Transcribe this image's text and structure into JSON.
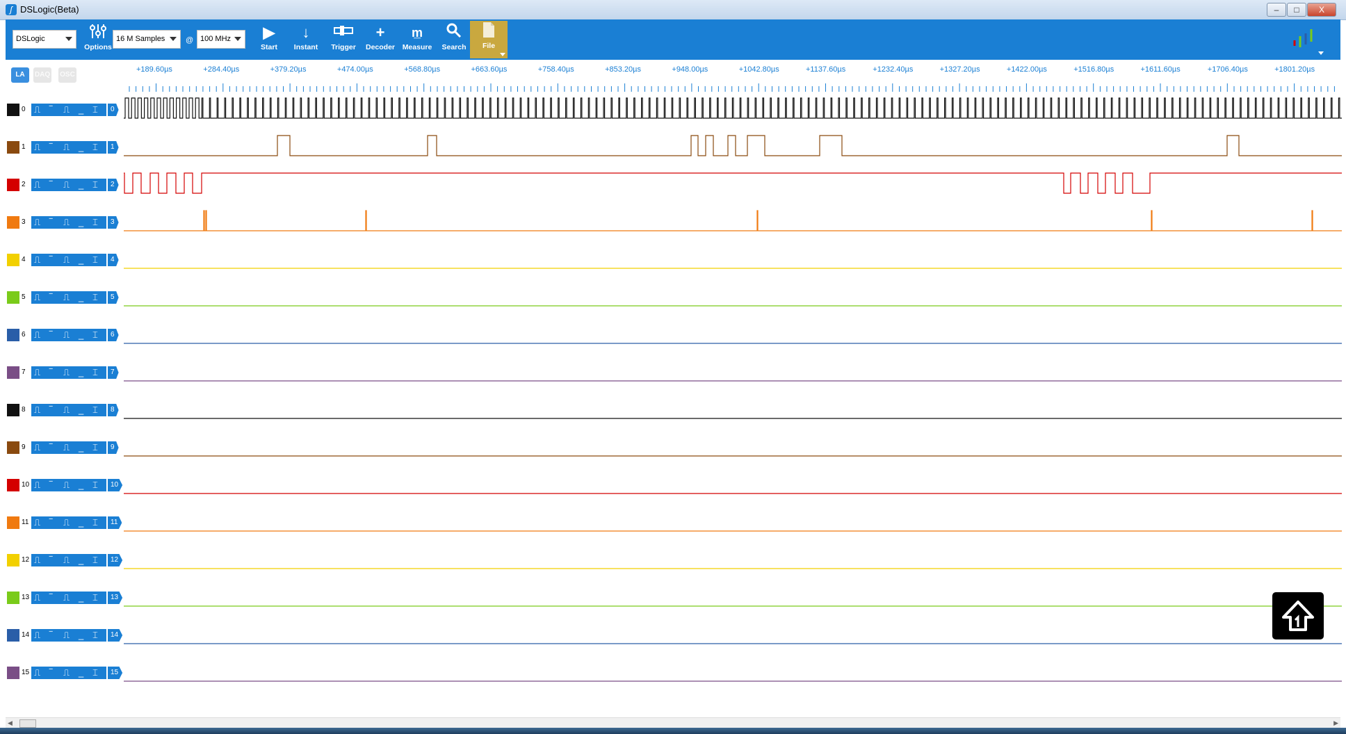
{
  "window": {
    "title": "DSLogic(Beta)",
    "min": "–",
    "max": "□",
    "close": "X"
  },
  "toolbar": {
    "device": "DSLogic",
    "options_label": "Options",
    "samples": "16 M Samples",
    "at": "@",
    "rate": "100 MHz",
    "start_label": "Start",
    "instant_label": "Instant",
    "trigger_label": "Trigger",
    "decoder_label": "Decoder",
    "measure_label": "Measure",
    "search_label": "Search",
    "file_label": "File"
  },
  "modes": {
    "la": "LA",
    "daq": "DAQ",
    "osc": "OSC"
  },
  "ruler": {
    "labels": [
      "+189.60µs",
      "+284.40µs",
      "+379.20µs",
      "+474.00µs",
      "+568.80µs",
      "+663.60µs",
      "+758.40µs",
      "+853.20µs",
      "+948.00µs",
      "+1042.80µs",
      "+1137.60µs",
      "+1232.40µs",
      "+1327.20µs",
      "+1422.00µs",
      "+1516.80µs",
      "+1611.60µs",
      "+1706.40µs",
      "+1801.20µs"
    ]
  },
  "channels": [
    {
      "index": "0",
      "color": "#111111"
    },
    {
      "index": "1",
      "color": "#8a4a0f"
    },
    {
      "index": "2",
      "color": "#d40000"
    },
    {
      "index": "3",
      "color": "#f07a10"
    },
    {
      "index": "4",
      "color": "#f2d000"
    },
    {
      "index": "5",
      "color": "#7acb1a"
    },
    {
      "index": "6",
      "color": "#2a5ea8"
    },
    {
      "index": "7",
      "color": "#7a4e86"
    },
    {
      "index": "8",
      "color": "#111111"
    },
    {
      "index": "9",
      "color": "#8a4a0f"
    },
    {
      "index": "10",
      "color": "#d40000"
    },
    {
      "index": "11",
      "color": "#f07a10"
    },
    {
      "index": "12",
      "color": "#f2d000"
    },
    {
      "index": "13",
      "color": "#7acb1a"
    },
    {
      "index": "14",
      "color": "#2a5ea8"
    },
    {
      "index": "15",
      "color": "#7a4e86"
    }
  ],
  "trigger_icons": [
    "rising-edge-icon",
    "high-level-icon",
    "falling-edge-icon",
    "low-level-icon",
    "any-edge-icon"
  ],
  "accent": "#1a7fd4"
}
